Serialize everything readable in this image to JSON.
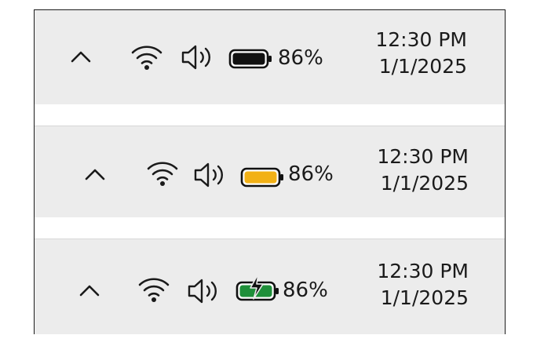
{
  "taskbar_variants": [
    {
      "battery_state": "normal",
      "battery_color": "#111111",
      "battery_percent_text": "86%",
      "clock_time": "12:30 PM",
      "clock_date": "1/1/2025",
      "icons": [
        "chevron-up-icon",
        "wifi-icon",
        "volume-icon",
        "battery-icon"
      ]
    },
    {
      "battery_state": "battery-saver",
      "battery_color": "#f2b116",
      "battery_percent_text": "86%",
      "clock_time": "12:30 PM",
      "clock_date": "1/1/2025",
      "icons": [
        "chevron-up-icon",
        "wifi-icon",
        "volume-icon",
        "battery-saver-icon"
      ]
    },
    {
      "battery_state": "charging",
      "battery_color": "#1f8f3a",
      "battery_percent_text": "86%",
      "clock_time": "12:30 PM",
      "clock_date": "1/1/2025",
      "icons": [
        "chevron-up-icon",
        "wifi-icon",
        "volume-icon",
        "battery-charging-icon"
      ]
    }
  ],
  "colors": {
    "taskbar_background": "#ececec",
    "icon_foreground": "#1a1a1a"
  }
}
